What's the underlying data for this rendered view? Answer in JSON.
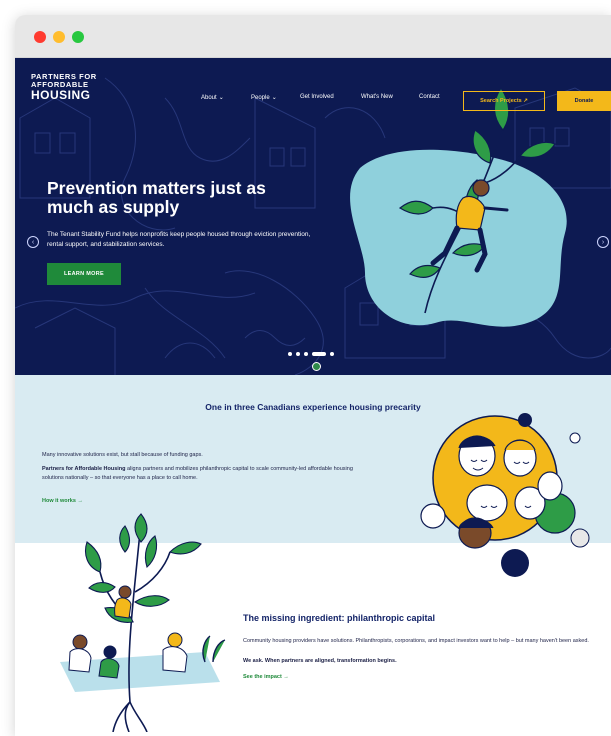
{
  "window": {
    "controls": [
      "close",
      "minimize",
      "zoom"
    ]
  },
  "logo": {
    "line1": "PARTNERS FOR",
    "line2": "AFFORDABLE",
    "line3": "HOUSING"
  },
  "nav": {
    "items": [
      {
        "label": "About",
        "has_dropdown": true
      },
      {
        "label": "People",
        "has_dropdown": true
      },
      {
        "label": "Get Involved",
        "has_dropdown": false
      },
      {
        "label": "What's New",
        "has_dropdown": false
      },
      {
        "label": "Contact",
        "has_dropdown": false
      }
    ],
    "search_label": "Search Projects ↗",
    "donate_label": "Donate"
  },
  "hero": {
    "title": "Prevention matters just as much as supply",
    "description": "The Tenant Stability Fund helps nonprofits keep people housed through eviction prevention, rental support, and stabilization services.",
    "cta_label": "LEARN MORE",
    "prev_icon": "chevron-left-icon",
    "next_icon": "chevron-right-icon",
    "slide_count": 5,
    "active_slide": 4
  },
  "precarity": {
    "heading": "One in three Canadians experience housing precarity",
    "intro": "Many innovative solutions exist, but stall because of funding gaps.",
    "body_bold": "Partners for Affordable Housing",
    "body_rest": " aligns partners and mobilizes philanthropic capital to scale community-led affordable housing solutions nationally – so that everyone has a place to call home.",
    "link_label": "How it works →"
  },
  "capital": {
    "title": "The missing ingredient: philanthropic capital",
    "body": "Community housing providers have solutions. Philanthropists, corporations, and impact investors want to help – but many haven't been asked.",
    "emphasis": "We ask. When partners are aligned, transformation begins.",
    "link_label": "See the impact →"
  },
  "colors": {
    "navy": "#0d1a52",
    "gold": "#f3b81a",
    "green": "#1f8a3a",
    "light_blue": "#d9ebf2",
    "blob": "#8fd0dc"
  }
}
